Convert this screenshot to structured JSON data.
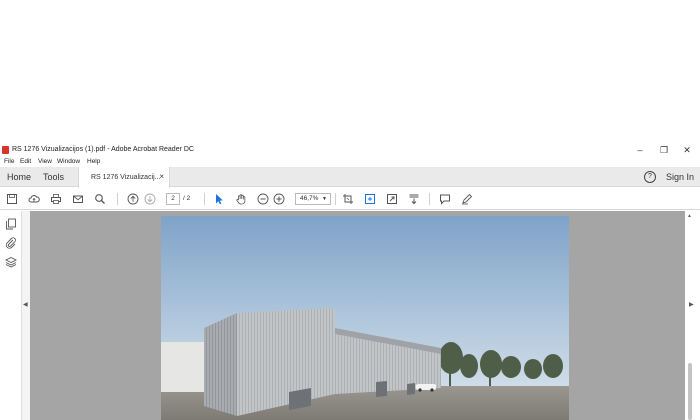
{
  "window": {
    "title": "RS 1276 Vizualizacijos (1).pdf - Adobe Acrobat Reader DC",
    "minimize": "–",
    "maximize": "❐",
    "close": "✕"
  },
  "menu": [
    "File",
    "Edit",
    "View",
    "Window",
    "Help"
  ],
  "tabs": {
    "home": "Home",
    "tools": "Tools",
    "document": "RS 1276 Vizualizacij...",
    "document_close": "×"
  },
  "header": {
    "help": "?",
    "signin": "Sign In"
  },
  "toolbar": {
    "page_current": "2",
    "page_total": "/ 2",
    "zoom": "46,7%"
  },
  "colors": {
    "accent_blue": "#1a73e8",
    "viewer_bg": "#a5a5a5"
  }
}
